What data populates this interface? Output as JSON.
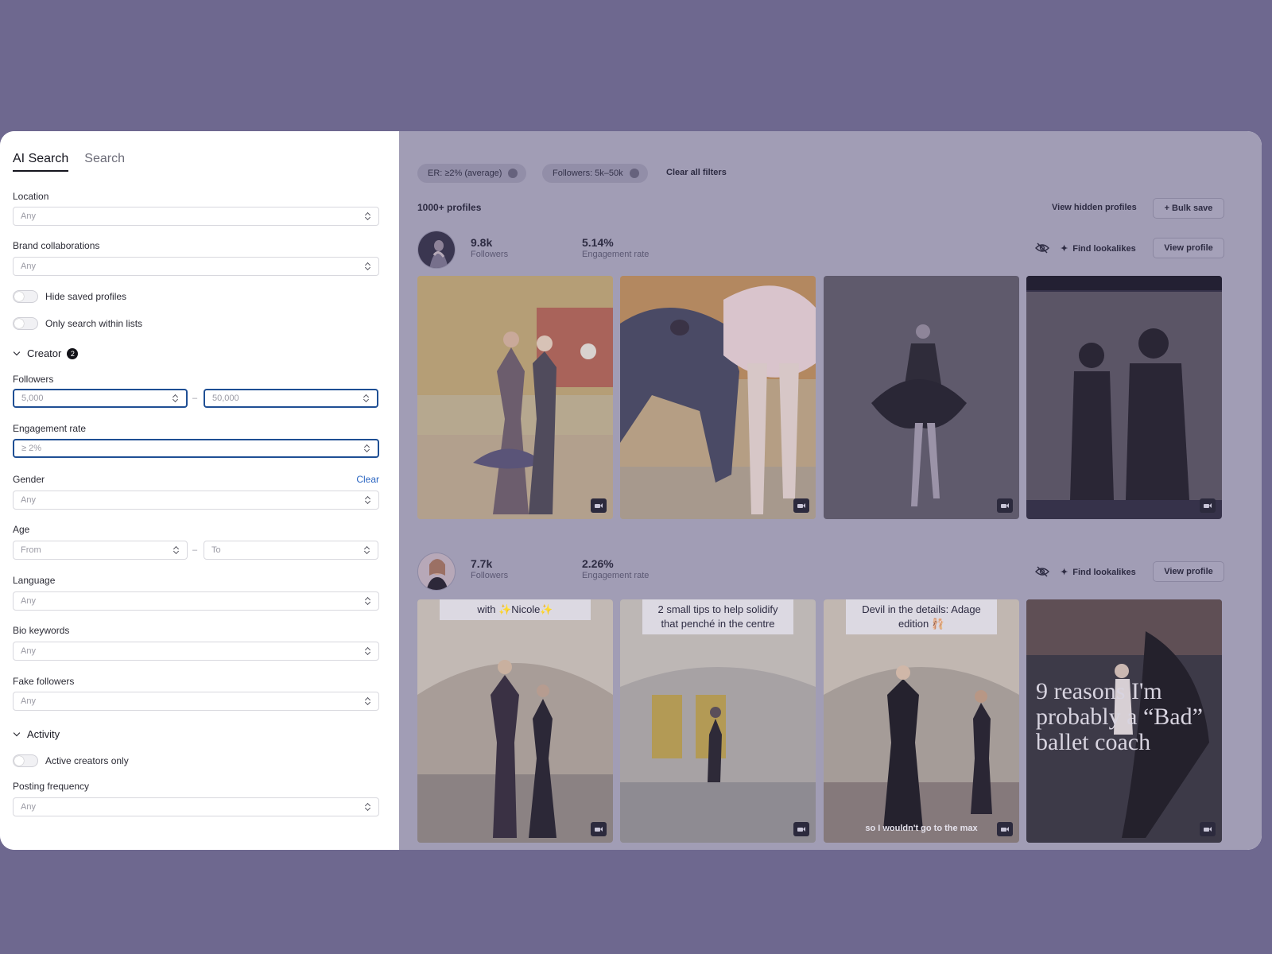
{
  "tabs": [
    {
      "label": "AI Search"
    },
    {
      "label": "Search"
    }
  ],
  "filters": {
    "location": {
      "label": "Location",
      "placeholder": "Any"
    },
    "brand": {
      "label": "Brand collaborations",
      "placeholder": "Any"
    },
    "hide_saved": {
      "label": "Hide saved profiles"
    },
    "within_lists": {
      "label": "Only search within lists"
    },
    "creator_section": {
      "label": "Creator",
      "count": "2"
    },
    "followers": {
      "label": "Followers",
      "min_placeholder": "5,000",
      "max_placeholder": "50,000",
      "dash": "–"
    },
    "engagement": {
      "label": "Engagement rate",
      "placeholder": "≥ 2%"
    },
    "gender": {
      "label": "Gender",
      "clear": "Clear",
      "placeholder": "Any"
    },
    "age": {
      "label": "Age",
      "from": "From",
      "to": "To",
      "dash": "–"
    },
    "language": {
      "label": "Language",
      "placeholder": "Any"
    },
    "bio": {
      "label": "Bio keywords",
      "placeholder": "Any"
    },
    "fake": {
      "label": "Fake followers",
      "placeholder": "Any"
    },
    "activity_section": {
      "label": "Activity"
    },
    "active_only": {
      "label": "Active creators only"
    },
    "posting": {
      "label": "Posting frequency",
      "placeholder": "Any"
    }
  },
  "results": {
    "chips": [
      {
        "label": "ER: ≥2% (average)"
      },
      {
        "label": "Followers: 5k–50k"
      }
    ],
    "clear_all": "Clear all filters",
    "count": "1000+ profiles",
    "view_hidden": "View hidden profiles",
    "bulk_save": "+ Bulk save",
    "profiles": [
      {
        "followers_value": "9.8k",
        "followers_label": "Followers",
        "er_value": "5.14%",
        "er_label": "Engagement rate",
        "lookalikes": "Find lookalikes",
        "view": "View profile"
      },
      {
        "followers_value": "7.7k",
        "followers_label": "Followers",
        "er_value": "2.26%",
        "er_label": "Engagement rate",
        "lookalikes": "Find lookalikes",
        "view": "View profile",
        "captions": {
          "p1": "with ✨Nicole✨",
          "p2": "2 small tips to help solidify that penché in the centre",
          "p3": "Devil in the details: Adage edition 🩰",
          "p3_sub": "so I wouldn't go to the max",
          "p4": "9 reasons I'm probably a “Bad” ballet coach"
        }
      }
    ]
  },
  "colors": {
    "background": "#6e688f",
    "accent": "#1f4f94",
    "link": "#2b66c2",
    "results_bg": "#a19db5"
  }
}
